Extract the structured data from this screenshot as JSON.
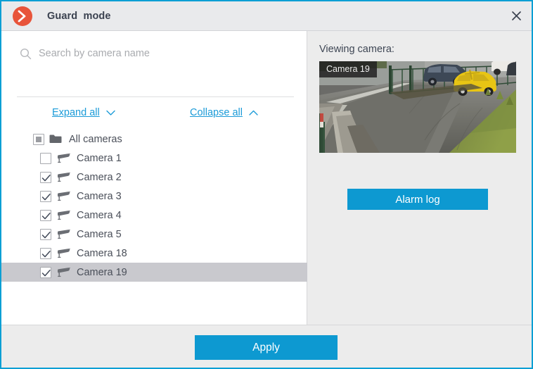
{
  "window": {
    "title": "Guard  mode",
    "app_icon": "orange-chevron-right-icon",
    "close_icon": "close-icon",
    "accent_color": "#0d99d1",
    "brand_color": "#e8543a",
    "border_color": "#0c9fd4"
  },
  "search": {
    "placeholder": "Search by camera name",
    "value": "",
    "icon": "search-icon"
  },
  "tree_controls": {
    "expand_label": "Expand all",
    "expand_icon": "chevron-down-icon",
    "collapse_label": "Collapse all",
    "collapse_icon": "chevron-up-icon"
  },
  "tree": {
    "root": {
      "label": "All cameras",
      "icon": "folder-icon",
      "checkbox_state": "indeterminate"
    },
    "items": [
      {
        "label": "Camera 1",
        "icon": "cctv-camera-icon",
        "checked": false,
        "selected": false
      },
      {
        "label": "Camera 2",
        "icon": "cctv-camera-icon",
        "checked": true,
        "selected": false
      },
      {
        "label": "Camera 3",
        "icon": "cctv-camera-icon",
        "checked": true,
        "selected": false
      },
      {
        "label": "Camera 4",
        "icon": "cctv-camera-icon",
        "checked": true,
        "selected": false
      },
      {
        "label": "Camera 5",
        "icon": "cctv-camera-icon",
        "checked": true,
        "selected": false
      },
      {
        "label": "Camera 18",
        "icon": "cctv-camera-icon",
        "checked": true,
        "selected": false
      },
      {
        "label": "Camera 19",
        "icon": "cctv-camera-icon",
        "checked": true,
        "selected": true
      }
    ]
  },
  "preview": {
    "title": "Viewing camera:",
    "camera_badge": "Camera 19",
    "alarm_log_label": "Alarm log"
  },
  "footer": {
    "apply_label": "Apply"
  }
}
